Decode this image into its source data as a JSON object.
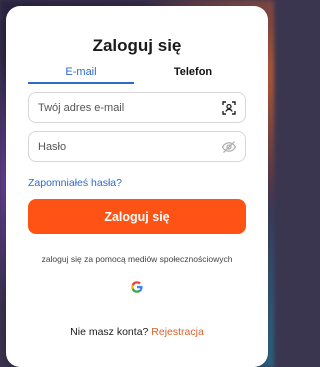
{
  "title": "Zaloguj się",
  "tabs": [
    {
      "label": "E-mail",
      "active": true
    },
    {
      "label": "Telefon",
      "active": false
    }
  ],
  "email_field": {
    "placeholder": "Twój adres e-mail",
    "value": "",
    "icon": "scan-icon"
  },
  "password_field": {
    "placeholder": "Hasło",
    "value": "",
    "icon": "eye-off-icon"
  },
  "forgot_password": "Zapomniałeś hasła?",
  "login_button": "Zaloguj się",
  "social_text": "zaloguj się za pomocą mediów społecznościowych",
  "social_providers": [
    "google-icon"
  ],
  "signup": {
    "prompt": "Nie masz konta?",
    "link": "Rejestracja"
  },
  "colors": {
    "accent": "#ff5315",
    "link": "#2f69c9",
    "signup_link": "#d9622a"
  }
}
